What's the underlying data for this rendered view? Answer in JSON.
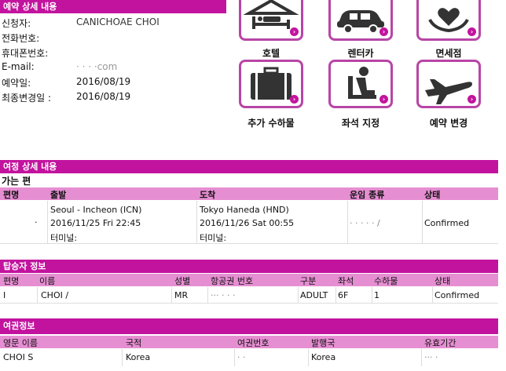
{
  "reservation": {
    "header": "예약 상세 내용",
    "fields": [
      {
        "label": "신청자:",
        "value": "CANICHOAE CHOI"
      },
      {
        "label": "전화번호:",
        "value": ""
      },
      {
        "label": "휴대폰번호:",
        "value": ""
      },
      {
        "label": "E-mail:",
        "value": "·  ·          ·  ·com"
      },
      {
        "label": "예약일:",
        "value": "2016/08/19"
      },
      {
        "label": "최종변경일 :",
        "value": "2016/08/19"
      }
    ]
  },
  "services": [
    {
      "label": "호텔",
      "icon": "hotel-bed-icon"
    },
    {
      "label": "렌터카",
      "icon": "car-icon"
    },
    {
      "label": "면세점",
      "icon": "gift-heart-icon"
    },
    {
      "label": "추가 수하물",
      "icon": "luggage-icon"
    },
    {
      "label": "좌석 지정",
      "icon": "seat-icon"
    },
    {
      "label": "예약 변경",
      "icon": "airplane-icon"
    }
  ],
  "itinerary": {
    "header": "여정 상세 내용",
    "direction": "가는 편",
    "columns": [
      "편명",
      "출발",
      "도착",
      "운임 종류",
      "상태"
    ],
    "row": {
      "flight": "·",
      "dep_city": "Seoul - Incheon (ICN)",
      "dep_time": "2016/11/25  Fri   22:45",
      "dep_terminal": "터미널:",
      "arr_city": "Tokyo Haneda (HND)",
      "arr_time": "2016/11/26  Sat  00:55",
      "arr_terminal": "터미널:",
      "fare": "· · · · · /",
      "status": "Confirmed"
    }
  },
  "passenger": {
    "header": "탑승자 정보",
    "columns": [
      "편명",
      "이름",
      "성별",
      "항공권 번호",
      "구분",
      "좌석",
      "수하물",
      "상태"
    ],
    "row": {
      "flight": "I",
      "name": "CHOI /",
      "gender": "MR",
      "ticket": "··· ·     · ·",
      "type": "ADULT",
      "seat": "6F",
      "baggage": "1",
      "status": "Confirmed"
    }
  },
  "passport": {
    "header": "여권정보",
    "columns": [
      "영문 이름",
      "국적",
      "여권번호",
      "발행국",
      "유효기간"
    ],
    "row": {
      "name": "CHOI S",
      "nationality": "Korea",
      "number": "· ·",
      "issuer": "Korea",
      "expiry": "··· ·"
    }
  },
  "colors": {
    "accent": "#c2139e",
    "subheader": "#e68ed2",
    "tile_border": "#b845a6"
  }
}
